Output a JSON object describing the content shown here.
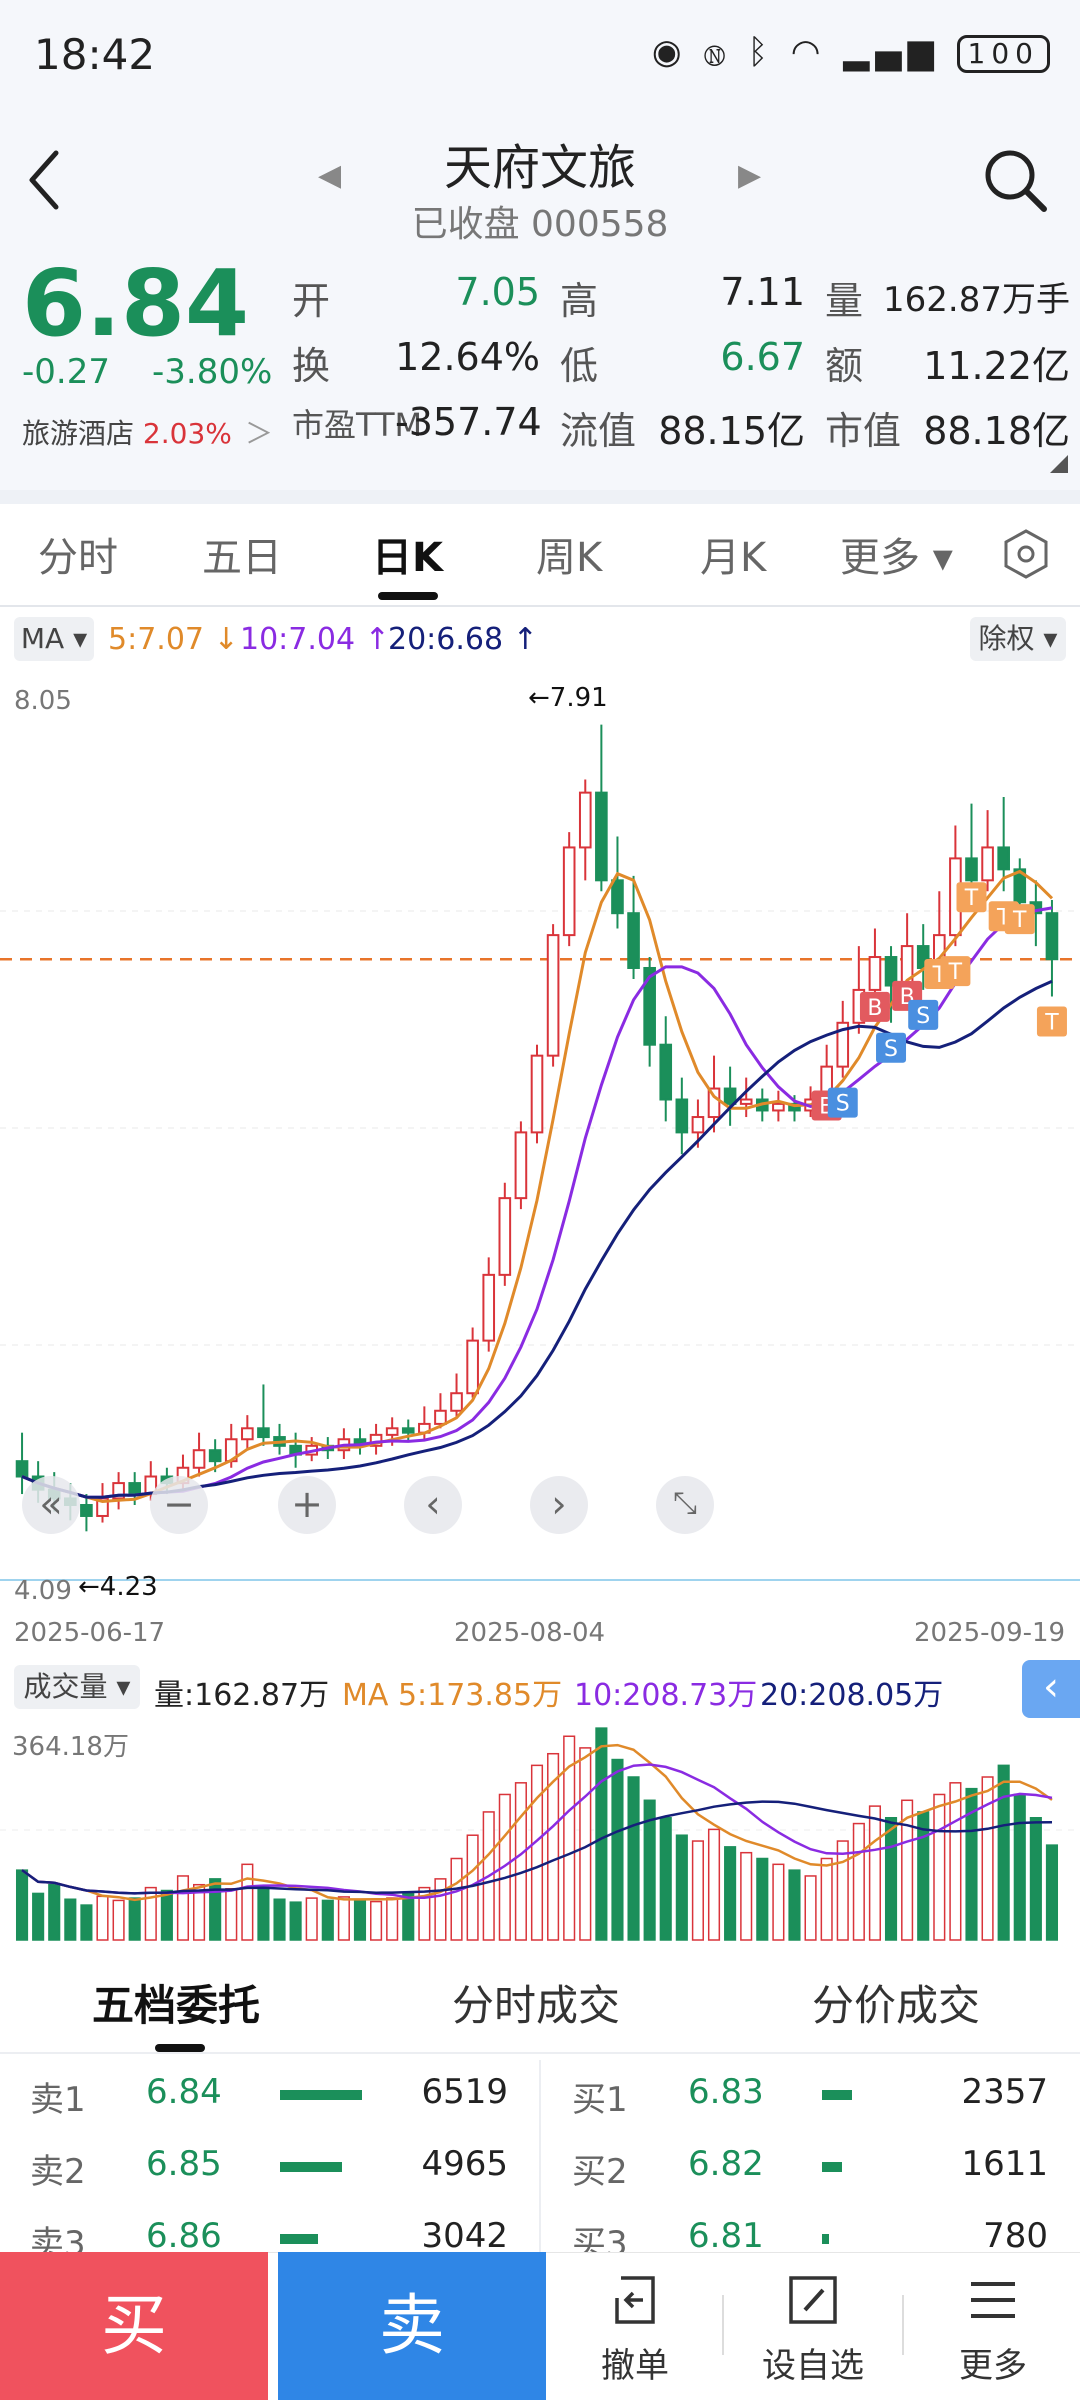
{
  "status_bar": {
    "time": "18:42",
    "battery": "100"
  },
  "header": {
    "stock_name": "天府文旅",
    "status_code": "已收盘 000558",
    "icons": [
      "back-icon",
      "prev-stock-icon",
      "next-stock-icon",
      "search-icon"
    ]
  },
  "quote": {
    "price": "6.84",
    "change": "-0.27",
    "change_pct": "-3.80%",
    "sector_name": "旅游酒店",
    "sector_pct": "2.03%",
    "fields": [
      {
        "label": "开",
        "value": "7.05"
      },
      {
        "label": "高",
        "value": "7.11"
      },
      {
        "label": "量",
        "value": "162.87万手"
      },
      {
        "label": "换",
        "value": "12.64%"
      },
      {
        "label": "低",
        "value": "6.67"
      },
      {
        "label": "额",
        "value": "11.22亿"
      },
      {
        "label": "市盈TTM",
        "value": "-357.74"
      },
      {
        "label": "流值",
        "value": "88.15亿"
      },
      {
        "label": "市值",
        "value": "88.18亿"
      }
    ],
    "colors": {
      "down": "#1b8f5a",
      "up": "#d9343a"
    }
  },
  "tabs": [
    {
      "label": "分时"
    },
    {
      "label": "五日"
    },
    {
      "label": "日K",
      "active": true
    },
    {
      "label": "周K"
    },
    {
      "label": "月K"
    },
    {
      "label": "更多 ▾"
    }
  ],
  "ma_bar": {
    "selector": "MA ▾",
    "ma5": "5:7.07 ↓",
    "ma10": "10:7.04 ↑",
    "ma20": "20:6.68 ↑",
    "adjust": "除权 ▾"
  },
  "kline": {
    "top_price": "8.05",
    "bottom_price": "4.09",
    "high_marker": "←7.91",
    "low_marker": "←4.23",
    "dates": [
      "2025-06-17",
      "2025-08-04",
      "2025-09-19"
    ],
    "chart_controls": [
      "«",
      "−",
      "+",
      "‹",
      "›",
      "⤡"
    ],
    "signals": [
      "B",
      "S",
      "B",
      "S",
      "B",
      "S",
      "T",
      "T",
      "T",
      "T",
      "T",
      "T"
    ]
  },
  "volume_bar": {
    "selector": "成交量 ▾",
    "volume": "量:162.87万",
    "ma5": "MA 5:173.85万",
    "ma10": "10:208.73万",
    "ma20": "20:208.05万",
    "max": "364.18万",
    "collapse": "‹"
  },
  "chart_data": {
    "type": "candlestick",
    "title": "",
    "x_range": [
      "2025-06-17",
      "2025-09-19"
    ],
    "ylim": [
      4.09,
      8.05
    ],
    "high_point": 7.91,
    "low_point": 4.23,
    "candles": [
      [
        4.55,
        4.48,
        4.68,
        4.4
      ],
      [
        4.48,
        4.42,
        4.55,
        4.36
      ],
      [
        4.42,
        4.38,
        4.5,
        4.32
      ],
      [
        4.38,
        4.35,
        4.45,
        4.28
      ],
      [
        4.35,
        4.3,
        4.4,
        4.23
      ],
      [
        4.3,
        4.38,
        4.45,
        4.27
      ],
      [
        4.38,
        4.45,
        4.5,
        4.33
      ],
      [
        4.45,
        4.4,
        4.5,
        4.35
      ],
      [
        4.4,
        4.48,
        4.55,
        4.37
      ],
      [
        4.48,
        4.45,
        4.52,
        4.4
      ],
      [
        4.45,
        4.52,
        4.58,
        4.42
      ],
      [
        4.52,
        4.6,
        4.68,
        4.48
      ],
      [
        4.6,
        4.55,
        4.65,
        4.5
      ],
      [
        4.55,
        4.65,
        4.72,
        4.52
      ],
      [
        4.65,
        4.7,
        4.76,
        4.6
      ],
      [
        4.7,
        4.66,
        4.9,
        4.62
      ],
      [
        4.66,
        4.62,
        4.72,
        4.58
      ],
      [
        4.62,
        4.58,
        4.68,
        4.52
      ],
      [
        4.58,
        4.62,
        4.66,
        4.55
      ],
      [
        4.62,
        4.6,
        4.66,
        4.56
      ],
      [
        4.6,
        4.65,
        4.7,
        4.56
      ],
      [
        4.65,
        4.62,
        4.7,
        4.58
      ],
      [
        4.62,
        4.67,
        4.72,
        4.58
      ],
      [
        4.67,
        4.7,
        4.75,
        4.62
      ],
      [
        4.7,
        4.68,
        4.74,
        4.64
      ],
      [
        4.68,
        4.72,
        4.8,
        4.65
      ],
      [
        4.72,
        4.78,
        4.86,
        4.7
      ],
      [
        4.78,
        4.86,
        4.95,
        4.75
      ],
      [
        4.86,
        5.1,
        5.16,
        4.84
      ],
      [
        5.1,
        5.4,
        5.48,
        5.05
      ],
      [
        5.4,
        5.75,
        5.82,
        5.35
      ],
      [
        5.75,
        6.05,
        6.1,
        5.7
      ],
      [
        6.05,
        6.4,
        6.45,
        6.0
      ],
      [
        6.4,
        6.95,
        7.0,
        6.35
      ],
      [
        6.95,
        7.35,
        7.42,
        6.9
      ],
      [
        7.35,
        7.6,
        7.66,
        7.2
      ],
      [
        7.6,
        7.2,
        7.91,
        7.15
      ],
      [
        7.2,
        7.05,
        7.4,
        6.98
      ],
      [
        7.05,
        6.8,
        7.22,
        6.75
      ],
      [
        6.8,
        6.45,
        6.85,
        6.35
      ],
      [
        6.45,
        6.2,
        6.58,
        6.1
      ],
      [
        6.2,
        6.05,
        6.3,
        5.95
      ],
      [
        6.05,
        6.12,
        6.2,
        5.98
      ],
      [
        6.12,
        6.25,
        6.4,
        6.05
      ],
      [
        6.25,
        6.18,
        6.35,
        6.08
      ],
      [
        6.18,
        6.2,
        6.3,
        6.12
      ],
      [
        6.2,
        6.15,
        6.25,
        6.1
      ],
      [
        6.15,
        6.18,
        6.24,
        6.1
      ],
      [
        6.18,
        6.15,
        6.22,
        6.1
      ],
      [
        6.15,
        6.2,
        6.26,
        6.12
      ],
      [
        6.2,
        6.35,
        6.45,
        6.15
      ],
      [
        6.35,
        6.55,
        6.65,
        6.3
      ],
      [
        6.55,
        6.7,
        6.9,
        6.5
      ],
      [
        6.7,
        6.85,
        6.98,
        6.6
      ],
      [
        6.85,
        6.72,
        6.9,
        6.55
      ],
      [
        6.72,
        6.9,
        7.05,
        6.65
      ],
      [
        6.9,
        6.8,
        7.0,
        6.7
      ],
      [
        6.8,
        6.95,
        7.15,
        6.75
      ],
      [
        6.95,
        7.3,
        7.45,
        6.9
      ],
      [
        7.3,
        7.2,
        7.55,
        7.1
      ],
      [
        7.2,
        7.35,
        7.52,
        7.15
      ],
      [
        7.35,
        7.25,
        7.58,
        7.15
      ],
      [
        7.25,
        7.1,
        7.3,
        7.0
      ],
      [
        7.1,
        7.05,
        7.2,
        6.9
      ],
      [
        7.05,
        6.84,
        7.11,
        6.67
      ]
    ],
    "volume_max": 364.18,
    "volumes": [
      120,
      80,
      95,
      70,
      60,
      75,
      68,
      72,
      90,
      85,
      110,
      95,
      105,
      88,
      130,
      92,
      70,
      65,
      72,
      68,
      74,
      70,
      66,
      72,
      80,
      90,
      105,
      140,
      180,
      220,
      250,
      270,
      300,
      320,
      350,
      330,
      364,
      310,
      280,
      240,
      210,
      180,
      170,
      190,
      160,
      150,
      140,
      130,
      120,
      110,
      140,
      170,
      200,
      230,
      210,
      240,
      220,
      250,
      270,
      260,
      280,
      300,
      250,
      210,
      163
    ]
  },
  "order_tabs": [
    {
      "label": "五档委托",
      "active": true
    },
    {
      "label": "分时成交"
    },
    {
      "label": "分价成交"
    }
  ],
  "order_book": {
    "sell": [
      {
        "label": "卖1",
        "price": "6.84",
        "qty": "6519",
        "ratio": 1.0
      },
      {
        "label": "卖2",
        "price": "6.85",
        "qty": "4965",
        "ratio": 0.76
      },
      {
        "label": "卖3",
        "price": "6.86",
        "qty": "3042",
        "ratio": 0.46
      }
    ],
    "buy": [
      {
        "label": "买1",
        "price": "6.83",
        "qty": "2357",
        "ratio": 0.36
      },
      {
        "label": "买2",
        "price": "6.82",
        "qty": "1611",
        "ratio": 0.24
      },
      {
        "label": "买3",
        "price": "6.81",
        "qty": "780",
        "ratio": 0.08
      }
    ]
  },
  "bottom_bar": {
    "buy": "买",
    "sell": "卖",
    "cancel": "撤单",
    "watch": "设自选",
    "more": "更多"
  }
}
